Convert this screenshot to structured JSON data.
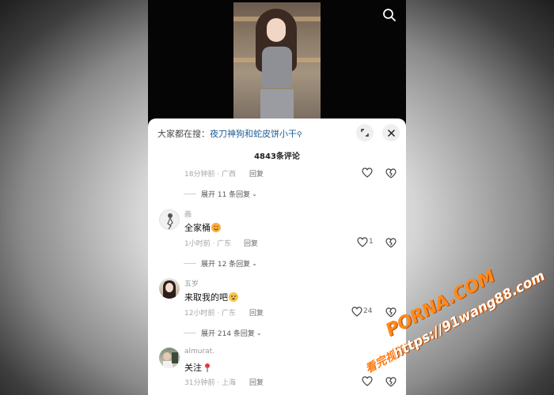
{
  "header": {
    "search_icon": "search-icon"
  },
  "sheet": {
    "hot_search_prefix": "大家都在搜：",
    "hot_search_keyword": "夜刀神狗和蛇皮饼小干",
    "hot_search_icon": "search-small-icon",
    "expand_icon": "expand-icon",
    "close_icon": "close-icon",
    "comment_count": "4843条评论"
  },
  "comments": [
    {
      "username": "",
      "text": "",
      "meta": "18分钟前 · 广西",
      "reply_label": "回复",
      "likes": "",
      "expand_label": "展开 11 条回复"
    },
    {
      "username": "画",
      "text": "全家桶",
      "emoji": "heart-eyes-emoji",
      "meta": "1小时前 · 广东",
      "reply_label": "回复",
      "likes": "1",
      "expand_label": "展开 12 条回复"
    },
    {
      "username": "五岁",
      "text": "来取我的吧",
      "emoji": "blush-emoji",
      "meta": "12小时前 · 广东",
      "reply_label": "回复",
      "likes": "24",
      "expand_label": "展开 214 条回复"
    },
    {
      "username": "almurat.",
      "text": "关注",
      "emoji": "rose-emoji",
      "meta": "31分钟前 · 上海",
      "reply_label": "回复",
      "likes": ""
    }
  ],
  "watermark": {
    "site": "PORNA.COM",
    "url": "https://91wang88.com",
    "badge": "看完视频:"
  },
  "colors": {
    "accent_link": "#1e5f95",
    "watermark_orange": "#ff8a1a"
  }
}
